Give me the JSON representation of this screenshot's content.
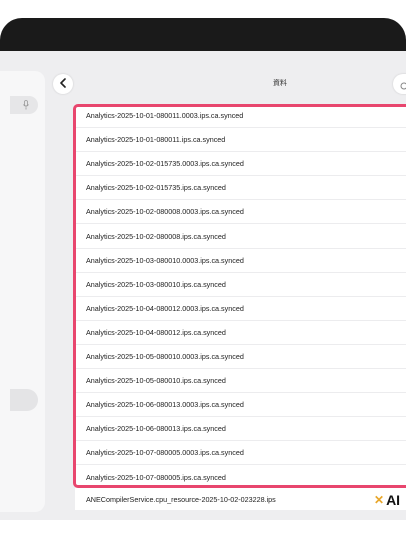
{
  "header": {
    "title": "資料"
  },
  "files": [
    "Analytics-2025-10-01-080011.0003.ips.ca.synced",
    "Analytics-2025-10-01-080011.ips.ca.synced",
    "Analytics-2025-10-02-015735.0003.ips.ca.synced",
    "Analytics-2025-10-02-015735.ips.ca.synced",
    "Analytics-2025-10-02-080008.0003.ips.ca.synced",
    "Analytics-2025-10-02-080008.ips.ca.synced",
    "Analytics-2025-10-03-080010.0003.ips.ca.synced",
    "Analytics-2025-10-03-080010.ips.ca.synced",
    "Analytics-2025-10-04-080012.0003.ips.ca.synced",
    "Analytics-2025-10-04-080012.ips.ca.synced",
    "Analytics-2025-10-05-080010.0003.ips.ca.synced",
    "Analytics-2025-10-05-080010.ips.ca.synced",
    "Analytics-2025-10-06-080013.0003.ips.ca.synced",
    "Analytics-2025-10-06-080013.ips.ca.synced",
    "Analytics-2025-10-07-080005.0003.ips.ca.synced",
    "Analytics-2025-10-07-080005.ips.ca.synced"
  ],
  "bottom_file": "ANECompilerService.cpu_resource-2025-10-02-023228.ips",
  "watermark": {
    "text": "AI"
  },
  "colors": {
    "highlight": "#e8466e",
    "logo_mark": "#e8a62a"
  },
  "icons": {
    "back": "chevron-left-icon",
    "search": "search-icon",
    "mic": "microphone-icon",
    "logo": "cross-mark-icon"
  }
}
